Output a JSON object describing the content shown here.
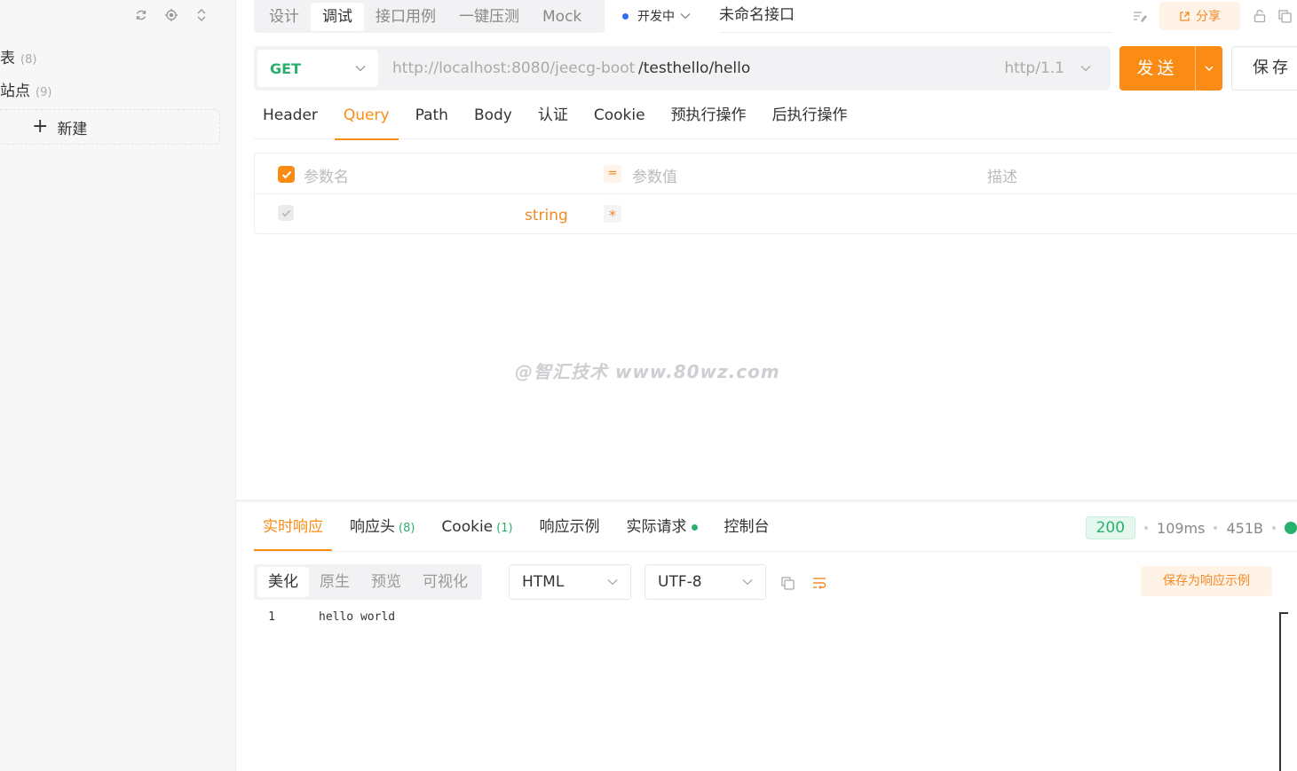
{
  "sidebar": {
    "items": [
      {
        "label": "表",
        "count": "(8)"
      },
      {
        "label": "站点",
        "count": "(9)"
      }
    ],
    "new_label": "新建"
  },
  "mode_tabs": [
    "设计",
    "调试",
    "接口用例",
    "一键压测",
    "Mock"
  ],
  "active_mode": "调试",
  "status": "开发中",
  "api_name": "未命名接口",
  "share_label": "分享",
  "request": {
    "method": "GET",
    "base_url": "http://localhost:8080/jeecg-boot",
    "path": "/testhello/hello",
    "protocol": "http/1.1",
    "send_label": "发送",
    "save_label": "保存"
  },
  "req_tabs": [
    "Header",
    "Query",
    "Path",
    "Body",
    "认证",
    "Cookie",
    "预执行操作",
    "后执行操作"
  ],
  "active_req_tab": "Query",
  "params": {
    "col_name": "参数名",
    "col_value": "参数值",
    "col_desc": "描述",
    "eq_symbol": "=",
    "row_type": "string",
    "row_required": "*"
  },
  "watermark": "@智汇技术 www.80wz.com",
  "response": {
    "tabs": [
      {
        "label": "实时响应",
        "count": ""
      },
      {
        "label": "响应头",
        "count": "(8)"
      },
      {
        "label": "Cookie",
        "count": "(1)"
      },
      {
        "label": "响应示例",
        "count": ""
      },
      {
        "label": "实际请求",
        "count": ""
      },
      {
        "label": "控制台",
        "count": ""
      }
    ],
    "status_code": "200",
    "time": "109ms",
    "size": "451B",
    "formats": [
      "美化",
      "原生",
      "预览",
      "可视化"
    ],
    "type_select": "HTML",
    "encoding_select": "UTF-8",
    "save_example_label": "保存为响应示例",
    "code_lines": [
      {
        "no": "1",
        "text": "hello world"
      }
    ]
  },
  "colors": {
    "accent": "#fa8c16",
    "success": "#27b16c",
    "status_dot": "#2f6cf5"
  }
}
